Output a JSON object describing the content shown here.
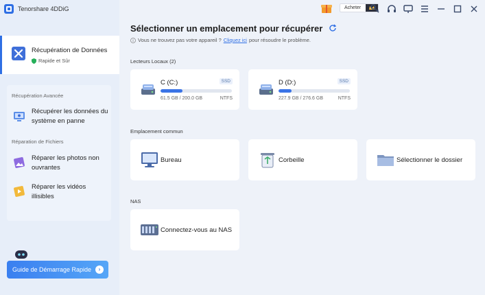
{
  "app": {
    "title": "Tenorshare 4DDiG"
  },
  "topbar": {
    "buy_label": "Acheter"
  },
  "sidebar": {
    "active": {
      "title": "Récupération de Données",
      "subtitle": "Rapide et Sûr"
    },
    "section_advanced": "Récupération Avancée",
    "item_crash": "Récupérer les données du système en panne",
    "section_repair": "Réparation de Fichiers",
    "item_photos": "Réparer les photos non ouvrantes",
    "item_videos": "Réparer les vidéos illisibles",
    "guide_button": "Guide de Démarrage Rapide"
  },
  "main": {
    "title": "Sélectionner un emplacement pour récupérer",
    "subtitle_text": "Vous ne trouvez pas votre appareil ?",
    "subtitle_link": "Cliquez ici",
    "subtitle_tail": "pour résoudre le problème.",
    "local_label": "Lecteurs Locaux (2)",
    "drives": [
      {
        "name": "C (C:)",
        "badge": "SSD",
        "size": "61.5 GB / 200.0 GB",
        "format": "NTFS",
        "used_fraction": 0.31
      },
      {
        "name": "D (D:)",
        "badge": "SSD",
        "size": "227.9 GB / 276.6 GB",
        "format": "NTFS",
        "used_fraction": 0.18
      }
    ],
    "common_label": "Emplacement commun",
    "common": {
      "desktop": "Bureau",
      "recycle": "Corbeille",
      "folder": "Sélectionner le dossier"
    },
    "nas_label": "NAS",
    "nas": {
      "connect": "Connectez-vous au NAS"
    }
  },
  "colors": {
    "accent": "#2f6fe4",
    "sidebar_bg": "#e7eef9",
    "main_bg": "#eef2f9"
  },
  "icons": [
    "logo-icon",
    "gift-icon",
    "crown-icon",
    "key-icon",
    "headset-icon",
    "feedback-icon",
    "menu-icon",
    "minimize-icon",
    "maximize-icon",
    "close-icon",
    "refresh-icon",
    "info-icon",
    "shield-icon",
    "tools-icon",
    "monitor-icon",
    "photo-icon",
    "video-icon",
    "robot-icon",
    "arrow-icon",
    "drive-icon",
    "desktop-icon",
    "recycle-bin-icon",
    "folder-icon",
    "nas-icon"
  ]
}
